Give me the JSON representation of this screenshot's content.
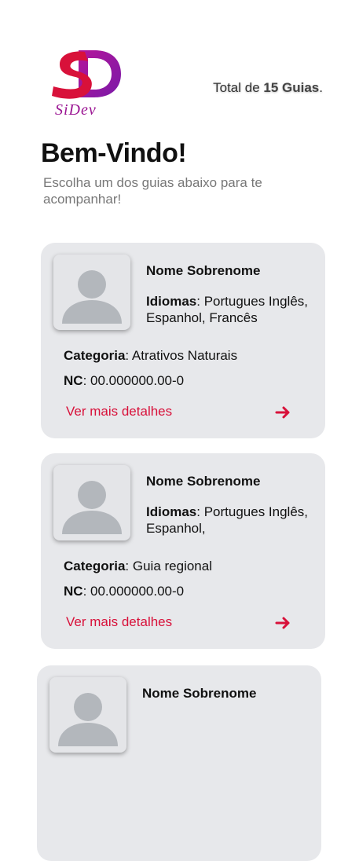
{
  "brand": {
    "logo_text": "SiDev",
    "logo_initials": "SD"
  },
  "header": {
    "total_prefix": "Total de",
    "total_bold": "15 Guias",
    "total_suffix": "."
  },
  "welcome": {
    "title": "Bem-Vindo!",
    "subtitle": "Escolha um dos guias abaixo para te acompanhar!"
  },
  "colors": {
    "accent": "#d8113a",
    "card_bg": "#e7e8eb",
    "avatar_icon": "#b3b7bc",
    "text_muted": "#777777"
  },
  "guides": [
    {
      "name": "Nome  Sobrenome",
      "languages_label": "Idiomas",
      "languages": ": Portugues Inglês, Espanhol, Francês",
      "category_label": "Categoria",
      "category": ": Atrativos Naturais",
      "nc_label": "NC",
      "nc": ": 00.000000.00-0",
      "details_label": "Ver mais detalhes",
      "arrow_icon": "arrow-right-icon"
    },
    {
      "name": "Nome  Sobrenome",
      "languages_label": "Idiomas",
      "languages": ": Portugues Inglês, Espanhol,",
      "category_label": "Categoria",
      "category": ": Guia regional",
      "nc_label": "NC",
      "nc": ": 00.000000.00-0",
      "details_label": "Ver mais detalhes",
      "arrow_icon": "arrow-right-icon"
    },
    {
      "name": "Nome  Sobrenome"
    }
  ]
}
